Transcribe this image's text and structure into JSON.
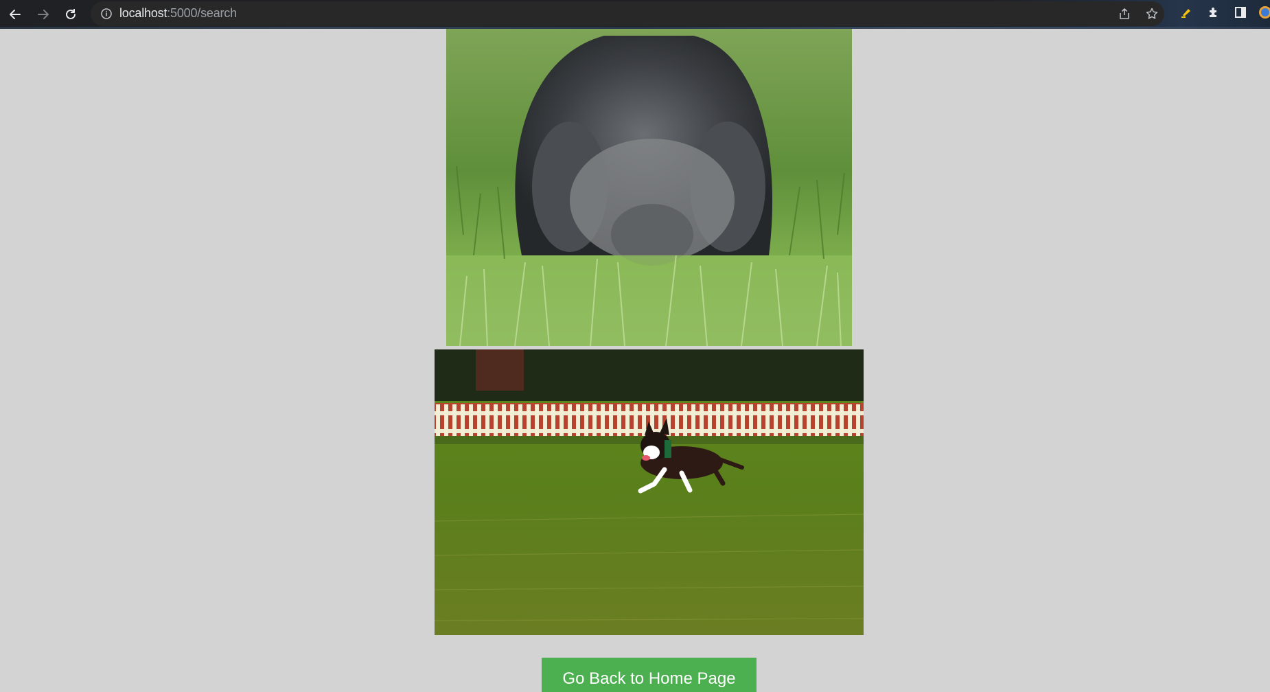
{
  "browser": {
    "url_host": "localhost",
    "url_path": ":5000/search"
  },
  "results": {
    "images": [
      {
        "icon": "dog-in-grass-photo"
      },
      {
        "icon": "boston-terrier-running-photo"
      }
    ]
  },
  "actions": {
    "home_button_label": "Go Back to Home Page"
  },
  "colors": {
    "page_background": "#d3d3d3",
    "button_background": "#4caf50",
    "button_text": "#ffffff"
  }
}
